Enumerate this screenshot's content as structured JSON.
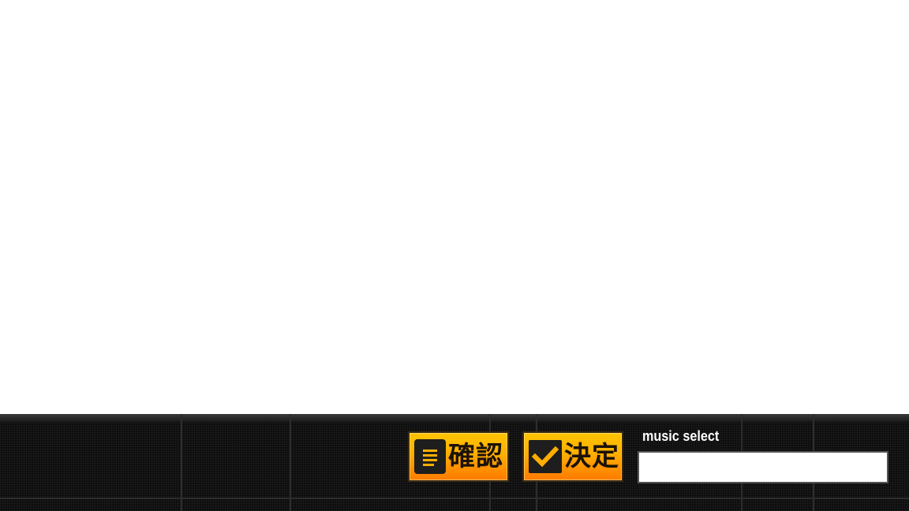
{
  "buttons": {
    "confirm_label": "確認",
    "decide_label": "決定"
  },
  "music_select": {
    "label": "music select",
    "value": ""
  },
  "icons": {
    "confirm": "document-icon",
    "decide": "checkmark-icon"
  },
  "colors": {
    "bar_background": "#0d0d0d",
    "button_top": "#ffc400",
    "button_bottom": "#ff7a00",
    "button_text": "#1c1208",
    "label_text": "#ffffff"
  }
}
